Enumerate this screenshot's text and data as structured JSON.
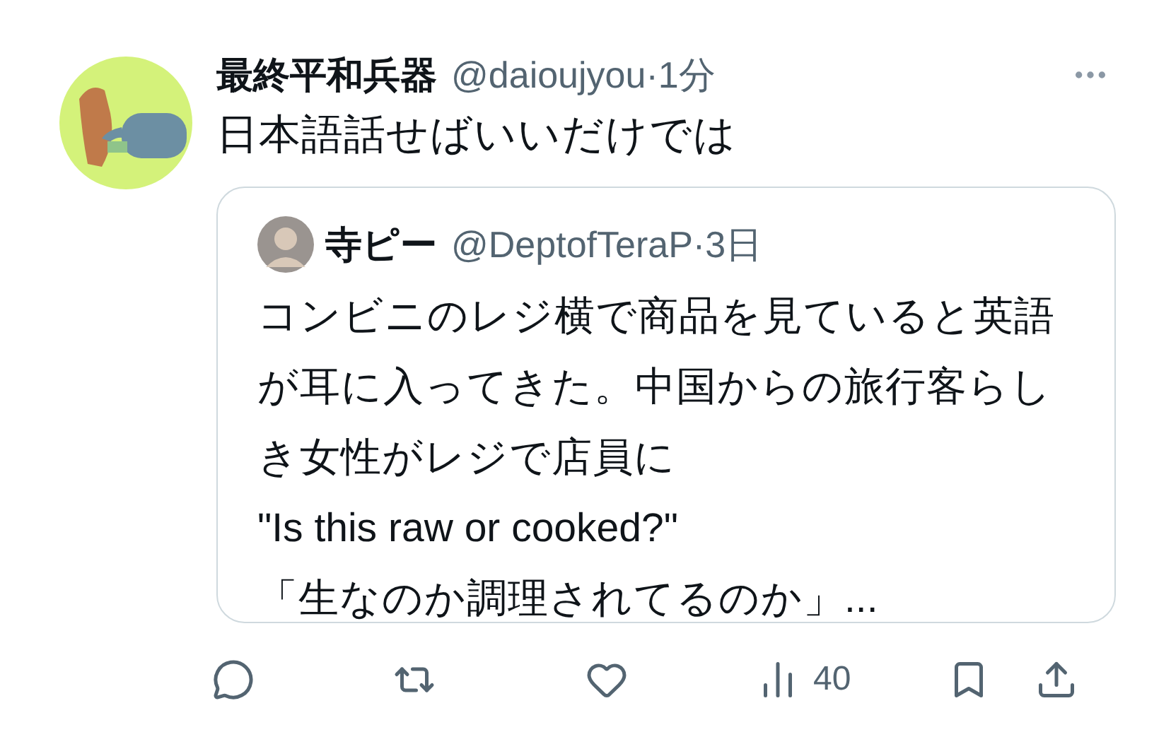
{
  "tweet": {
    "name": "最終平和兵器",
    "handle": "@daioujyou",
    "time": "·1分",
    "text": "日本語話せばいいだけでは",
    "quote": {
      "name": "寺ピー",
      "handle": "@DeptofTeraP",
      "time": "·3日",
      "paragraphs": [
        "コンビニのレジ横で商品を見ていると英語が耳に入ってきた。中国からの旅行客らしき女性がレジで店員に",
        "\"Is this raw or cooked?\"",
        "「生なのか調理されてるのか」..."
      ]
    },
    "actions": [
      {
        "kind": "reply"
      },
      {
        "kind": "retweet"
      },
      {
        "kind": "like"
      },
      {
        "kind": "views",
        "count": "40"
      },
      {
        "kind": "bookmark"
      },
      {
        "kind": "share"
      }
    ]
  }
}
